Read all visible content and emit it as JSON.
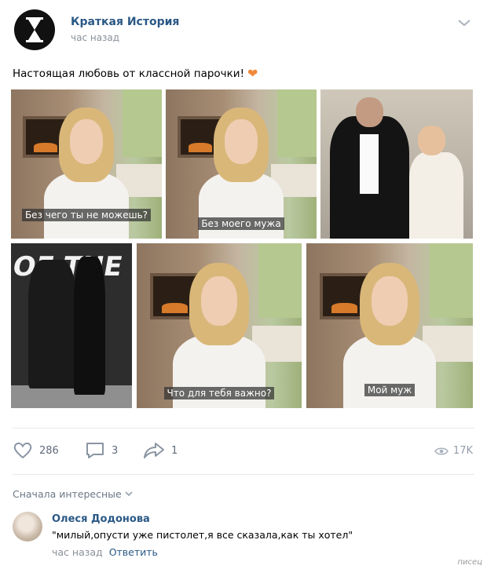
{
  "post": {
    "author": "Краткая История",
    "time": "час назад",
    "text": "Настоящая любовь от классной парочки!",
    "emoji": "❤"
  },
  "photos": [
    {
      "caption": "Без чего ты не можешь?"
    },
    {
      "caption": "Без моего мужа"
    },
    {
      "caption": ""
    },
    {
      "caption": ""
    },
    {
      "caption": "Что для тебя важно?"
    },
    {
      "caption": "Мой муж"
    }
  ],
  "actions": {
    "likes": "286",
    "comments": "3",
    "shares": "1",
    "views": "17K"
  },
  "comments": {
    "sort_label": "Сначала интересные",
    "items": [
      {
        "author": "Олеся Додонова",
        "text": "\"милый,опусти уже пистолет,я все сказала,как ты хотел\"",
        "time": "час назад",
        "reply_label": "Ответить"
      }
    ]
  },
  "watermark": "писец",
  "colors": {
    "link": "#2a5885",
    "muted": "#8a9099",
    "icon": "#6b7785"
  }
}
